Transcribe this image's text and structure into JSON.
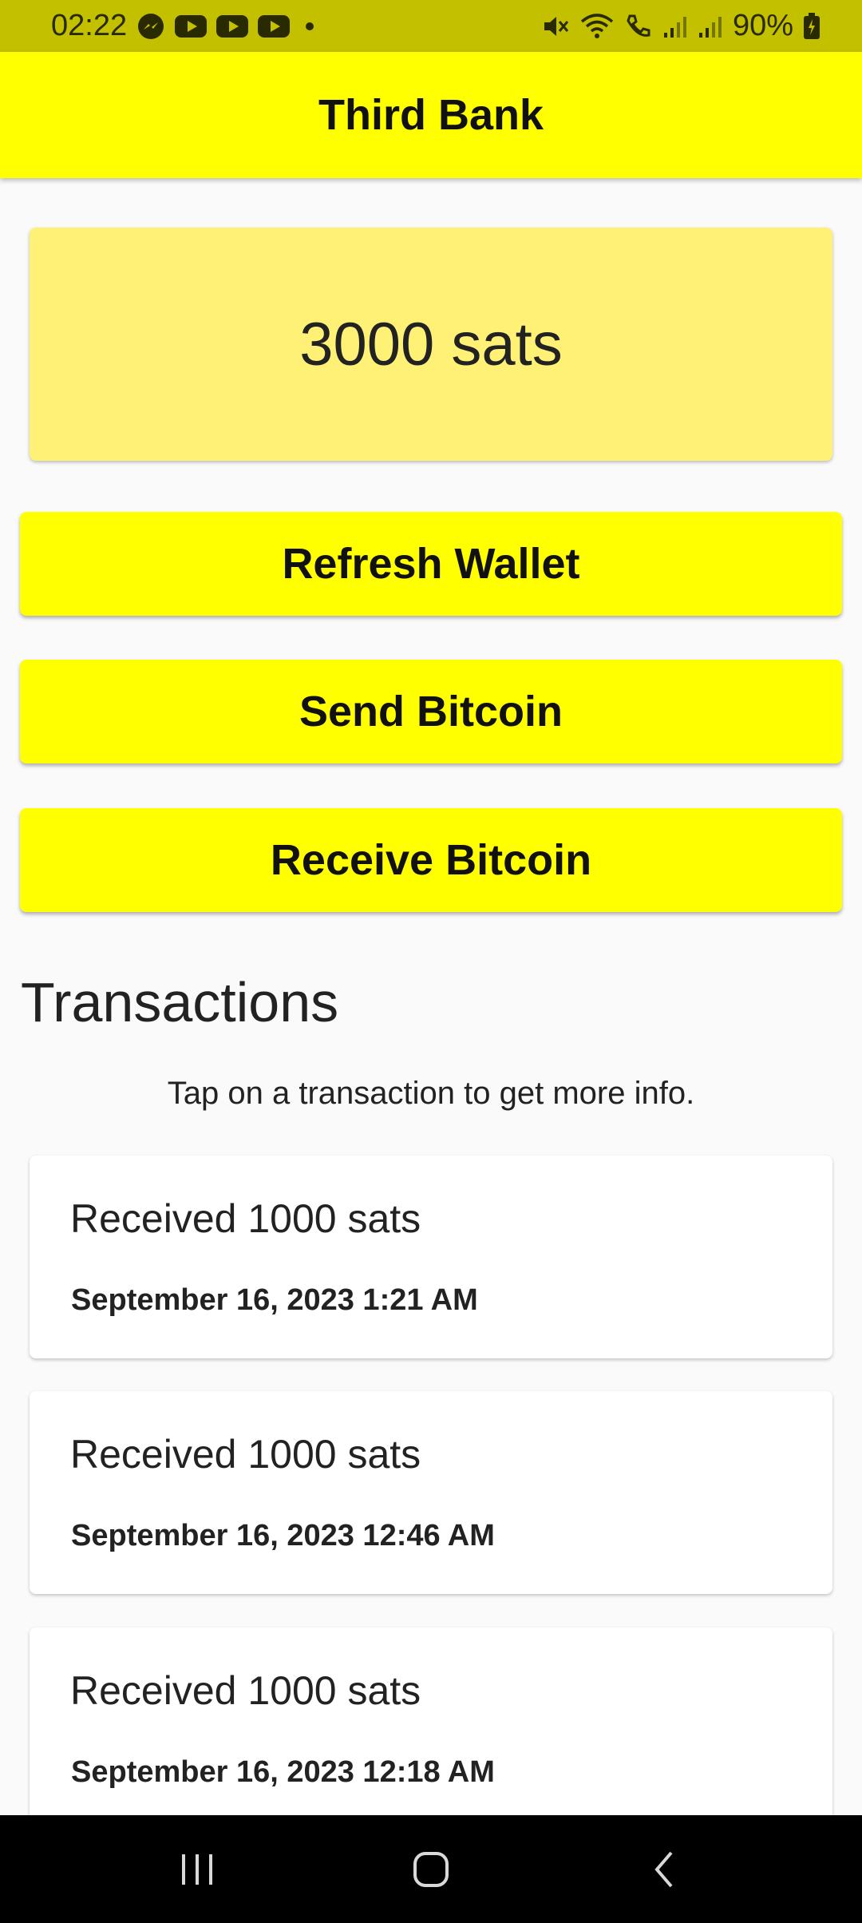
{
  "status_bar": {
    "time": "02:22",
    "battery": "90%",
    "icons": [
      "messenger-icon",
      "youtube-icon",
      "youtube-icon",
      "youtube-icon",
      "notification-dot",
      "mute-icon",
      "wifi-icon",
      "call-icon",
      "signal-icon",
      "signal-icon",
      "battery-icon"
    ]
  },
  "app_bar": {
    "title": "Third Bank"
  },
  "balance": {
    "text": "3000 sats"
  },
  "buttons": {
    "refresh": "Refresh Wallet",
    "send": "Send Bitcoin",
    "receive": "Receive Bitcoin"
  },
  "transactions": {
    "title": "Transactions",
    "hint": "Tap on a transaction to get more info.",
    "items": [
      {
        "title": "Received 1000 sats",
        "date": "September 16, 2023 1:21 AM"
      },
      {
        "title": "Received 1000 sats",
        "date": "September 16, 2023 12:46 AM"
      },
      {
        "title": "Received 1000 sats",
        "date": "September 16, 2023 12:18 AM"
      }
    ]
  },
  "colors": {
    "status_bar": "#c3c000",
    "app_bar": "#ffff00",
    "balance_card": "#fff176",
    "background": "#fafafa",
    "nav_bar": "#000000"
  }
}
